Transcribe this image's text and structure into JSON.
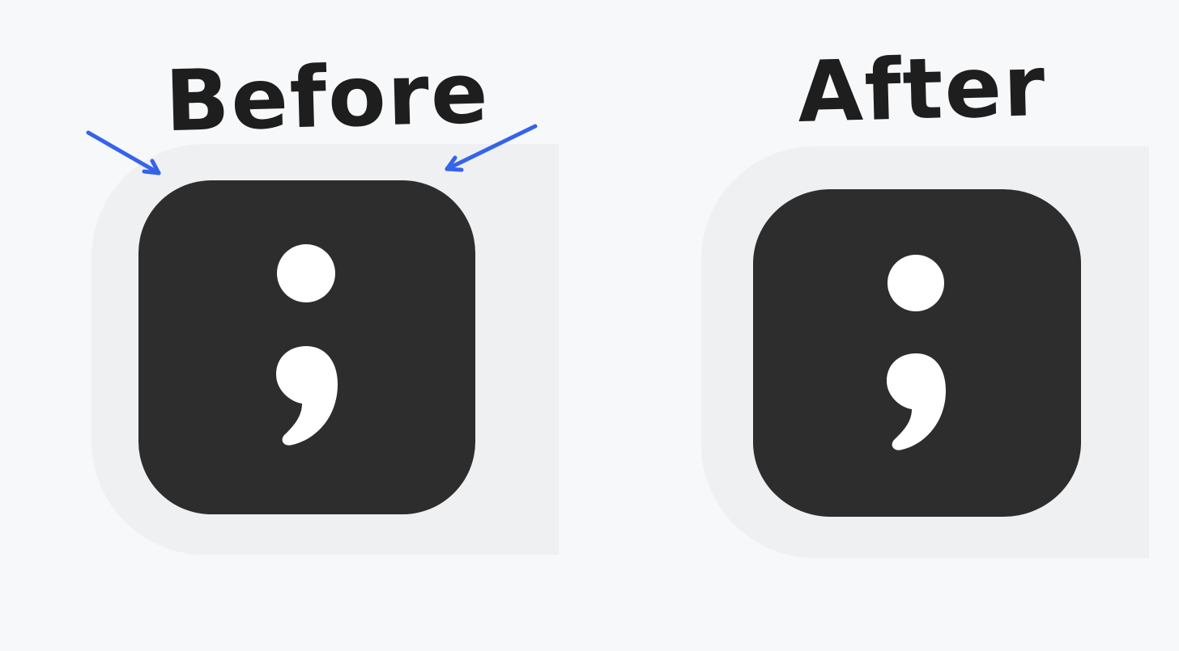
{
  "labels": {
    "before": "Before",
    "after": "After"
  },
  "icons": {
    "before": "semicolon-app-icon",
    "after": "semicolon-app-icon",
    "arrow": "arrow-icon"
  },
  "colors": {
    "background": "#f7f8fa",
    "panel": "#eff0f2",
    "icon_tile": "#2d2d2d",
    "glyph": "#ffffff",
    "arrow": "#3563e9",
    "text": "#1e1e1e"
  }
}
